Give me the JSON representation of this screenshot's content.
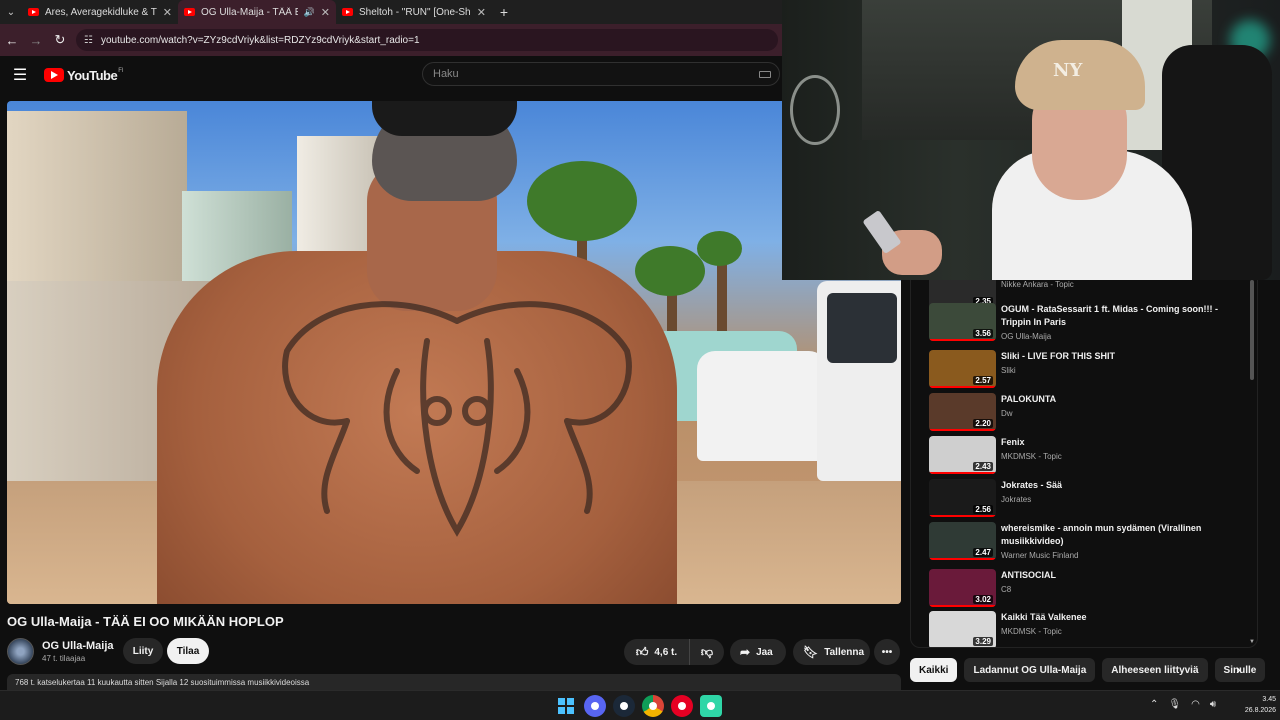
{
  "browser": {
    "tabs": [
      {
        "title": "Ares, Averagekidluke & Turisti",
        "active": false
      },
      {
        "title": "OG Ulla-Maija - TÄÄ EI OO",
        "active": true
      },
      {
        "title": "Sheltoh - \"RUN\" [One-Shot] - \\",
        "active": false
      }
    ],
    "new_tab": "+",
    "url": "youtube.com/watch?v=ZYz9cdVriyk&list=RDZYz9cdVriyk&start_radio=1"
  },
  "masthead": {
    "logo_text": "YouTube",
    "country": "FI",
    "search_placeholder": "Haku"
  },
  "video": {
    "title": "OG Ulla-Maija - TÄÄ EI OO MIKÄÄN HOPLOP",
    "channel": "OG Ulla-Maija",
    "subscribers": "47 t. tilaajaa",
    "join_label": "Liity",
    "subscribe_label": "Tilaa",
    "likes": "4,6 t.",
    "share_label": "Jaa",
    "save_label": "Tallenna",
    "description": "768 t. katselukertaa  11 kuukautta sitten  Sijalla 12 suosituimmissa musiikkivideoissa"
  },
  "sidebar": {
    "items": [
      {
        "title": "",
        "channel": "Nikke Ankara - Topic",
        "duration": "2.35",
        "thumb": "#2a2a2a"
      },
      {
        "title": "OGUM - RataSessarit 1 ft. Midas - Coming soon!!! - Trippin In Paris",
        "channel": "OG Ulla-Maija",
        "duration": "3.56",
        "thumb": "#3c4a3a"
      },
      {
        "title": "Sliki - LIVE FOR THIS SHIT",
        "channel": "Sliki",
        "duration": "2.57",
        "thumb": "#8a5a1e"
      },
      {
        "title": "PALOKUNTA",
        "channel": "Dw",
        "duration": "2.20",
        "thumb": "#5a3a2a"
      },
      {
        "title": "Fenix",
        "channel": "MKDMSK - Topic",
        "duration": "2.43",
        "thumb": "#cfcfcf"
      },
      {
        "title": "Jokrates - Sää",
        "channel": "Jokrates",
        "duration": "2.56",
        "thumb": "#1a1a1a"
      },
      {
        "title": "whereismike - annoin mun sydämen (Virallinen musiikkivideo)",
        "channel": "Warner Music Finland",
        "duration": "2.47",
        "thumb": "#2f3a35"
      },
      {
        "title": "ANTISOCIAL",
        "channel": "C8",
        "duration": "3.02",
        "thumb": "#6a1a3a"
      },
      {
        "title": "Kaikki Tää Valkenee",
        "channel": "MKDMSK - Topic",
        "duration": "3.29",
        "thumb": "#d8d8d8"
      }
    ]
  },
  "chips": [
    "Kaikki",
    "Ladannut OG Ulla-Maija",
    "Alheeseen liittyviä",
    "Sinulle"
  ],
  "webcam": {
    "cap_logo": "NY"
  },
  "taskbar": {
    "time": "3.45",
    "date": "26.8.2026"
  },
  "colors": {
    "accent": "#ff0000",
    "tab_active": "#3c1f2b",
    "background": "#0f0f0f"
  }
}
